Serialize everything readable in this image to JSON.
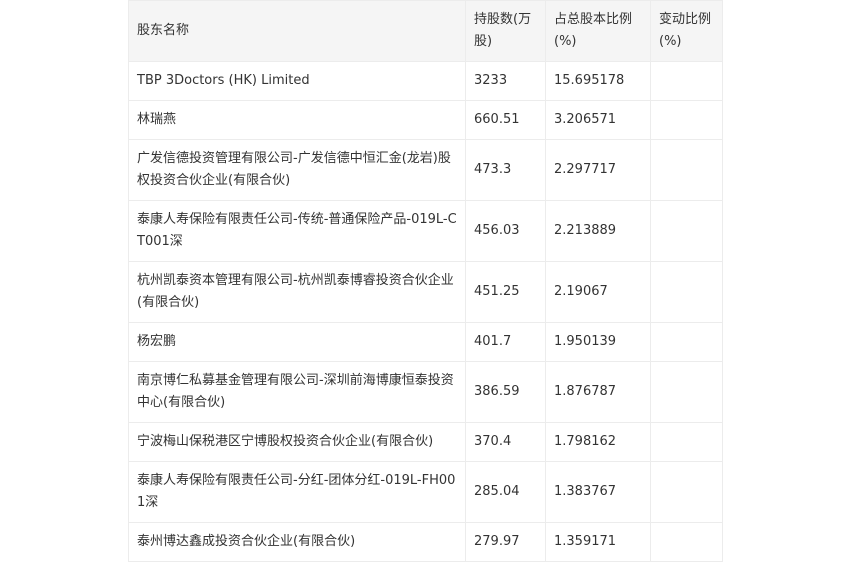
{
  "table": {
    "headers": [
      "股东名称",
      "持股数(万股)",
      "占总股本比例(%)",
      "变动比例(%)"
    ],
    "rows": [
      {
        "name": "TBP 3Doctors (HK) Limited",
        "shares": "3233",
        "ratio": "15.695178",
        "change": ""
      },
      {
        "name": "林瑞燕",
        "shares": "660.51",
        "ratio": "3.206571",
        "change": ""
      },
      {
        "name": "广发信德投资管理有限公司-广发信德中恒汇金(龙岩)股权投资合伙企业(有限合伙)",
        "shares": "473.3",
        "ratio": "2.297717",
        "change": ""
      },
      {
        "name": "泰康人寿保险有限责任公司-传统-普通保险产品-019L-CT001深",
        "shares": "456.03",
        "ratio": "2.213889",
        "change": ""
      },
      {
        "name": "杭州凯泰资本管理有限公司-杭州凯泰博睿投资合伙企业(有限合伙)",
        "shares": "451.25",
        "ratio": "2.19067",
        "change": ""
      },
      {
        "name": "杨宏鹏",
        "shares": "401.7",
        "ratio": "1.950139",
        "change": ""
      },
      {
        "name": "南京博仁私募基金管理有限公司-深圳前海博康恒泰投资中心(有限合伙)",
        "shares": "386.59",
        "ratio": "1.876787",
        "change": ""
      },
      {
        "name": "宁波梅山保税港区宁博股权投资合伙企业(有限合伙)",
        "shares": "370.4",
        "ratio": "1.798162",
        "change": ""
      },
      {
        "name": "泰康人寿保险有限责任公司-分红-团体分红-019L-FH001深",
        "shares": "285.04",
        "ratio": "1.383767",
        "change": ""
      },
      {
        "name": "泰州博达鑫成投资合伙企业(有限合伙)",
        "shares": "279.97",
        "ratio": "1.359171",
        "change": ""
      }
    ]
  }
}
